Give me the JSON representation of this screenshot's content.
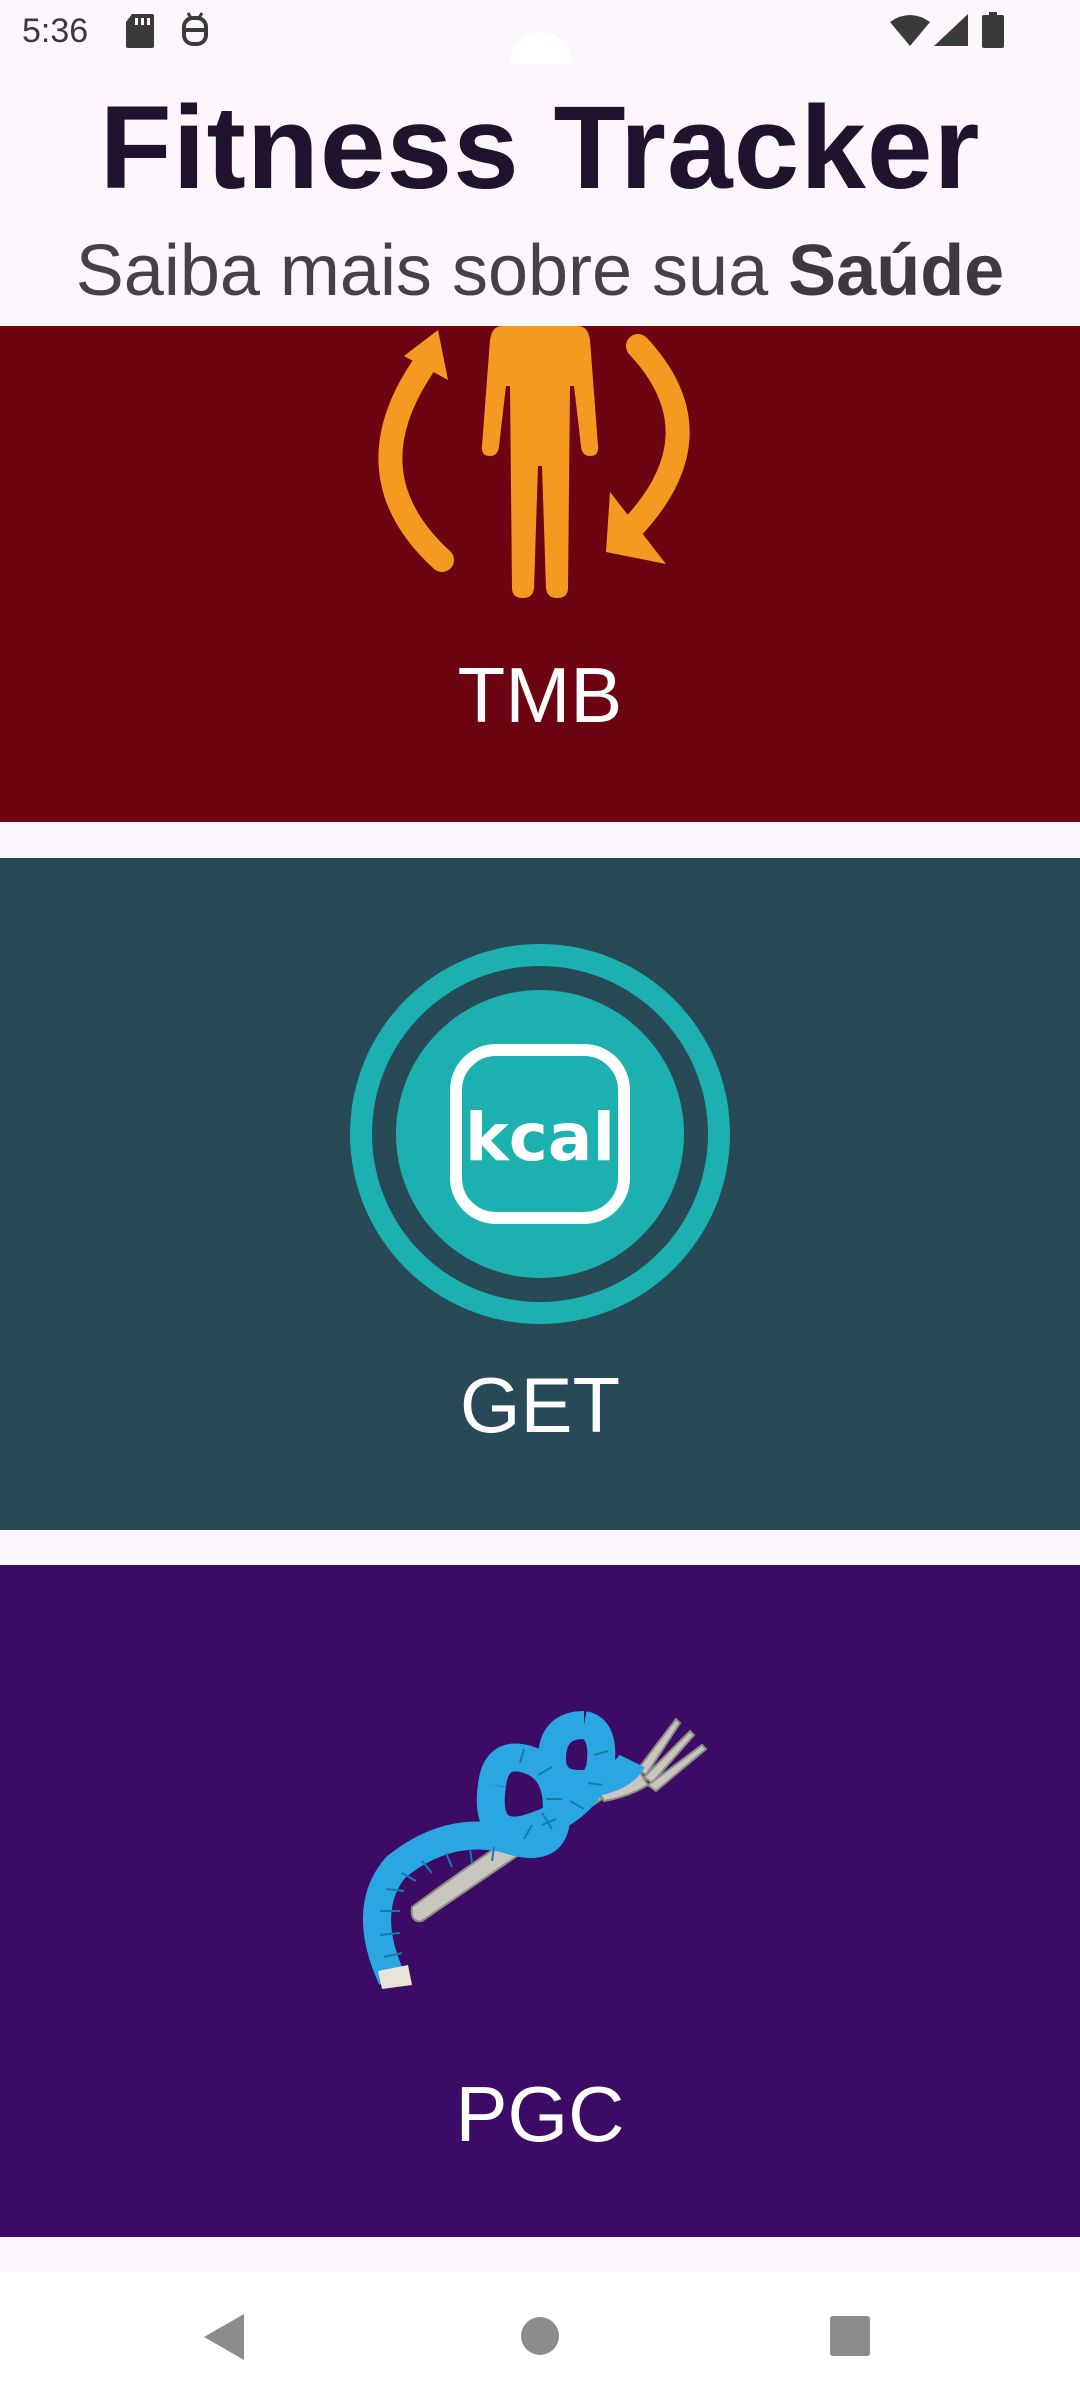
{
  "status_bar": {
    "time": "5:36",
    "icons": [
      "sd-card-icon",
      "android-debug-icon",
      "wifi-icon",
      "signal-icon",
      "battery-icon"
    ]
  },
  "header": {
    "title": "Fitness Tracker",
    "subtitle_prefix": "Saiba mais sobre sua ",
    "subtitle_emphasis": "Saúde"
  },
  "cards": [
    {
      "label": "TMB",
      "icon": "body-rotation-icon",
      "color": "#6c0411"
    },
    {
      "label": "GET",
      "icon": "kcal-icon",
      "color": "#274a56"
    },
    {
      "label": "PGC",
      "icon": "measuring-tape-fork-icon",
      "color": "#3b0b66"
    }
  ],
  "nav_bar": {
    "buttons": [
      "back",
      "home",
      "recents"
    ]
  }
}
